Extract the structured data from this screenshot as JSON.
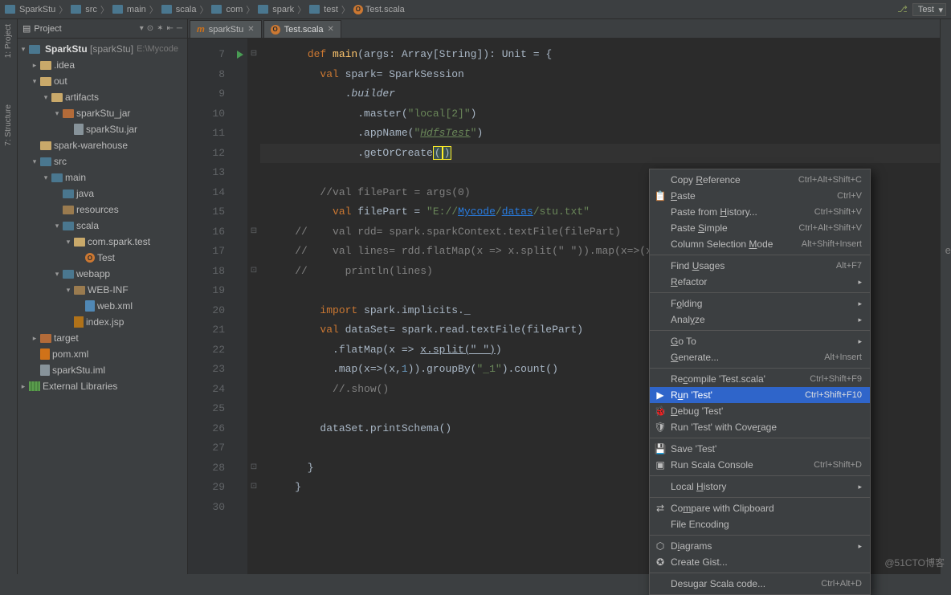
{
  "breadcrumb": [
    "SparkStu",
    "src",
    "main",
    "scala",
    "com",
    "spark",
    "test",
    "Test.scala"
  ],
  "runConfig": "Test",
  "leftGutter": {
    "project": "1: Project",
    "structure": "7: Structure"
  },
  "projectPanel": {
    "title": "Project"
  },
  "tree": {
    "root": {
      "label": "SparkStu",
      "module": "[sparkStu]",
      "hint": "E:\\Mycode"
    },
    "idea": ".idea",
    "out": "out",
    "artifacts": "artifacts",
    "sparkStuJar": "sparkStu_jar",
    "jar": "sparkStu.jar",
    "warehouse": "spark-warehouse",
    "src": "src",
    "main": "main",
    "java": "java",
    "resources": "resources",
    "scala": "scala",
    "pkg": "com.spark.test",
    "obj": "Test",
    "webapp": "webapp",
    "webinf": "WEB-INF",
    "webxml": "web.xml",
    "indexjsp": "index.jsp",
    "target": "target",
    "pom": "pom.xml",
    "iml": "sparkStu.iml",
    "extlib": "External Libraries"
  },
  "tabs": [
    {
      "label": "sparkStu",
      "kind": "m"
    },
    {
      "label": "Test.scala",
      "kind": "o"
    }
  ],
  "activeTab": 1,
  "code": {
    "start": 7,
    "lines": [
      {
        "n": 7,
        "run": true,
        "fold": "⊟",
        "html": "<span class='kw'>def</span> <span class='fn'>main</span>(args: Array[<span class='ty'>String</span>]): <span class='ty'>Unit</span> = {",
        "ind": 3
      },
      {
        "n": 8,
        "html": "<span class='kw'>val</span> spark= SparkSession",
        "ind": 4
      },
      {
        "n": 9,
        "html": ".<span class='it'>builder</span>",
        "ind": 6
      },
      {
        "n": 10,
        "html": ".master(<span class='str'>\"local[2]\"</span>)",
        "ind": 7
      },
      {
        "n": 11,
        "html": ".appName(<span class='str'>\"</span><span class='grn-it'>HdfsTest</span><span class='str'>\"</span>)",
        "ind": 7
      },
      {
        "n": 12,
        "hl": true,
        "html": ".getOrCreate<span class='paren-hl'>(</span><span class='paren-hl'>)</span>",
        "ind": 7
      },
      {
        "n": 13,
        "html": "",
        "ind": 0
      },
      {
        "n": 14,
        "html": "<span class='cm'>//val filePart = args(0)</span>",
        "ind": 4
      },
      {
        "n": 15,
        "html": "<span class='kw'>val</span> filePart = <span class='str'>\"E://</span><span class='lk'>Mycode</span><span class='str'>/</span><span class='lk'>datas</span><span class='str'>/stu.txt\"</span>",
        "ind": 5
      },
      {
        "n": 16,
        "fold": "⊟",
        "html": "<span class='cm'>//    val rdd= spark.sparkContext.textFile(filePart)</span>",
        "ind": 2
      },
      {
        "n": 17,
        "html": "<span class='cm'>//    val lines= rdd.flatMap(x =&gt; x.split(\" \")).map(x=&gt;(x,1</span>",
        "ind": 2,
        "tail": "ect().toList"
      },
      {
        "n": 18,
        "fold": "⊡",
        "html": "<span class='cm'>//      println(lines)</span>",
        "ind": 2
      },
      {
        "n": 19,
        "html": "",
        "ind": 0
      },
      {
        "n": 20,
        "html": "<span class='kw'>import</span> spark.implicits._",
        "ind": 4
      },
      {
        "n": 21,
        "html": "<span class='kw'>val</span> dataSet= spark.read.textFile(filePart)",
        "ind": 4
      },
      {
        "n": 22,
        "html": ".flatMap(x =&gt; <span style='text-decoration:underline'>x.split(\" \")</span>)",
        "ind": 5
      },
      {
        "n": 23,
        "html": ".map(x=&gt;(x,<span class='dc'>1</span>)).groupBy(<span class='str'>\"_1\"</span>).count()",
        "ind": 5
      },
      {
        "n": 24,
        "html": "<span class='cm'>//.show()</span>",
        "ind": 5
      },
      {
        "n": 25,
        "html": "",
        "ind": 0
      },
      {
        "n": 26,
        "html": "dataSet.printSchema()",
        "ind": 4
      },
      {
        "n": 27,
        "html": "",
        "ind": 0
      },
      {
        "n": 28,
        "fold": "⊡",
        "html": "}",
        "ind": 3
      },
      {
        "n": 29,
        "fold": "⊡",
        "html": "}",
        "ind": 2
      },
      {
        "n": 30,
        "html": "",
        "ind": 0
      }
    ]
  },
  "menu": [
    {
      "t": "item",
      "label": "Copy Reference",
      "sc": "Ctrl+Alt+Shift+C",
      "und": 5
    },
    {
      "t": "item",
      "label": "Paste",
      "sc": "Ctrl+V",
      "ico": "📋",
      "und": 0
    },
    {
      "t": "item",
      "label": "Paste from History...",
      "sc": "Ctrl+Shift+V",
      "und": 11
    },
    {
      "t": "item",
      "label": "Paste Simple",
      "sc": "Ctrl+Alt+Shift+V",
      "und": 6
    },
    {
      "t": "item",
      "label": "Column Selection Mode",
      "sc": "Alt+Shift+Insert",
      "und": 17
    },
    {
      "t": "sep"
    },
    {
      "t": "item",
      "label": "Find Usages",
      "sc": "Alt+F7",
      "und": 5
    },
    {
      "t": "sub",
      "label": "Refactor",
      "und": 0
    },
    {
      "t": "sep"
    },
    {
      "t": "sub",
      "label": "Folding",
      "und": 1
    },
    {
      "t": "sub",
      "label": "Analyze",
      "und": 4
    },
    {
      "t": "sep"
    },
    {
      "t": "sub",
      "label": "Go To",
      "und": 0
    },
    {
      "t": "item",
      "label": "Generate...",
      "sc": "Alt+Insert",
      "und": 0
    },
    {
      "t": "sep"
    },
    {
      "t": "item",
      "label": "Recompile 'Test.scala'",
      "sc": "Ctrl+Shift+F9",
      "und": 2
    },
    {
      "t": "item",
      "label": "Run 'Test'",
      "sc": "Ctrl+Shift+F10",
      "ico": "▶",
      "sel": true,
      "und": 1
    },
    {
      "t": "item",
      "label": "Debug 'Test'",
      "ico": "🐞",
      "und": 0
    },
    {
      "t": "item",
      "label": "Run 'Test' with Coverage",
      "ico": "🛡",
      "und": 20
    },
    {
      "t": "sep"
    },
    {
      "t": "item",
      "label": "Save 'Test'",
      "ico": "💾"
    },
    {
      "t": "item",
      "label": "Run Scala Console",
      "sc": "Ctrl+Shift+D",
      "ico": "▣"
    },
    {
      "t": "sep"
    },
    {
      "t": "sub",
      "label": "Local History",
      "und": 6
    },
    {
      "t": "sep"
    },
    {
      "t": "item",
      "label": "Compare with Clipboard",
      "ico": "⇄",
      "und": 2
    },
    {
      "t": "item",
      "label": "File Encoding"
    },
    {
      "t": "sep"
    },
    {
      "t": "sub",
      "label": "Diagrams",
      "ico": "⬡",
      "und": 1
    },
    {
      "t": "item",
      "label": "Create Gist...",
      "ico": "✪"
    },
    {
      "t": "sep"
    },
    {
      "t": "item",
      "label": "Desugar Scala code...",
      "sc": "Ctrl+Alt+D"
    }
  ],
  "watermark": "@51CTO博客"
}
